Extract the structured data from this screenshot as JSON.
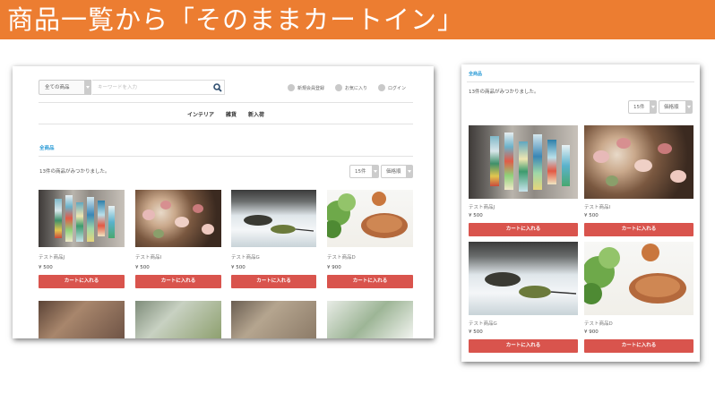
{
  "banner": {
    "title": "商品一覧から「そのままカートイン」"
  },
  "desktop": {
    "search": {
      "category": "全ての商品",
      "placeholder": "キーワードを入力"
    },
    "header_links": [
      "新規会員登録",
      "お気に入り",
      "ログイン"
    ],
    "nav": [
      "インテリア",
      "雑貨",
      "新入荷"
    ],
    "breadcrumb": "全商品",
    "result_count": "13件の商品がみつかりました。",
    "per_page": "15件",
    "sort": "価格順",
    "products": [
      {
        "name": "テスト商品J",
        "price": "¥ 500",
        "cart": "カートに入れる"
      },
      {
        "name": "テスト商品I",
        "price": "¥ 500",
        "cart": "カートに入れる"
      },
      {
        "name": "テスト商品G",
        "price": "¥ 500",
        "cart": "カートに入れる"
      },
      {
        "name": "テスト商品D",
        "price": "¥ 900",
        "cart": "カートに入れる"
      }
    ]
  },
  "mobile": {
    "breadcrumb": "全商品",
    "result_count": "13件の商品がみつかりました。",
    "per_page": "15件",
    "sort": "価格順",
    "products": [
      {
        "name": "テスト商品J",
        "price": "¥ 500",
        "cart": "カートに入れる"
      },
      {
        "name": "テスト商品I",
        "price": "¥ 500",
        "cart": "カートに入れる"
      },
      {
        "name": "テスト商品G",
        "price": "¥ 500",
        "cart": "カートに入れる"
      },
      {
        "name": "テスト商品D",
        "price": "¥ 900",
        "cart": "カートに入れる"
      }
    ]
  },
  "colors": {
    "banner": "#ec7d31",
    "cart_button": "#d9544d",
    "breadcrumb": "#2b9bd6"
  }
}
